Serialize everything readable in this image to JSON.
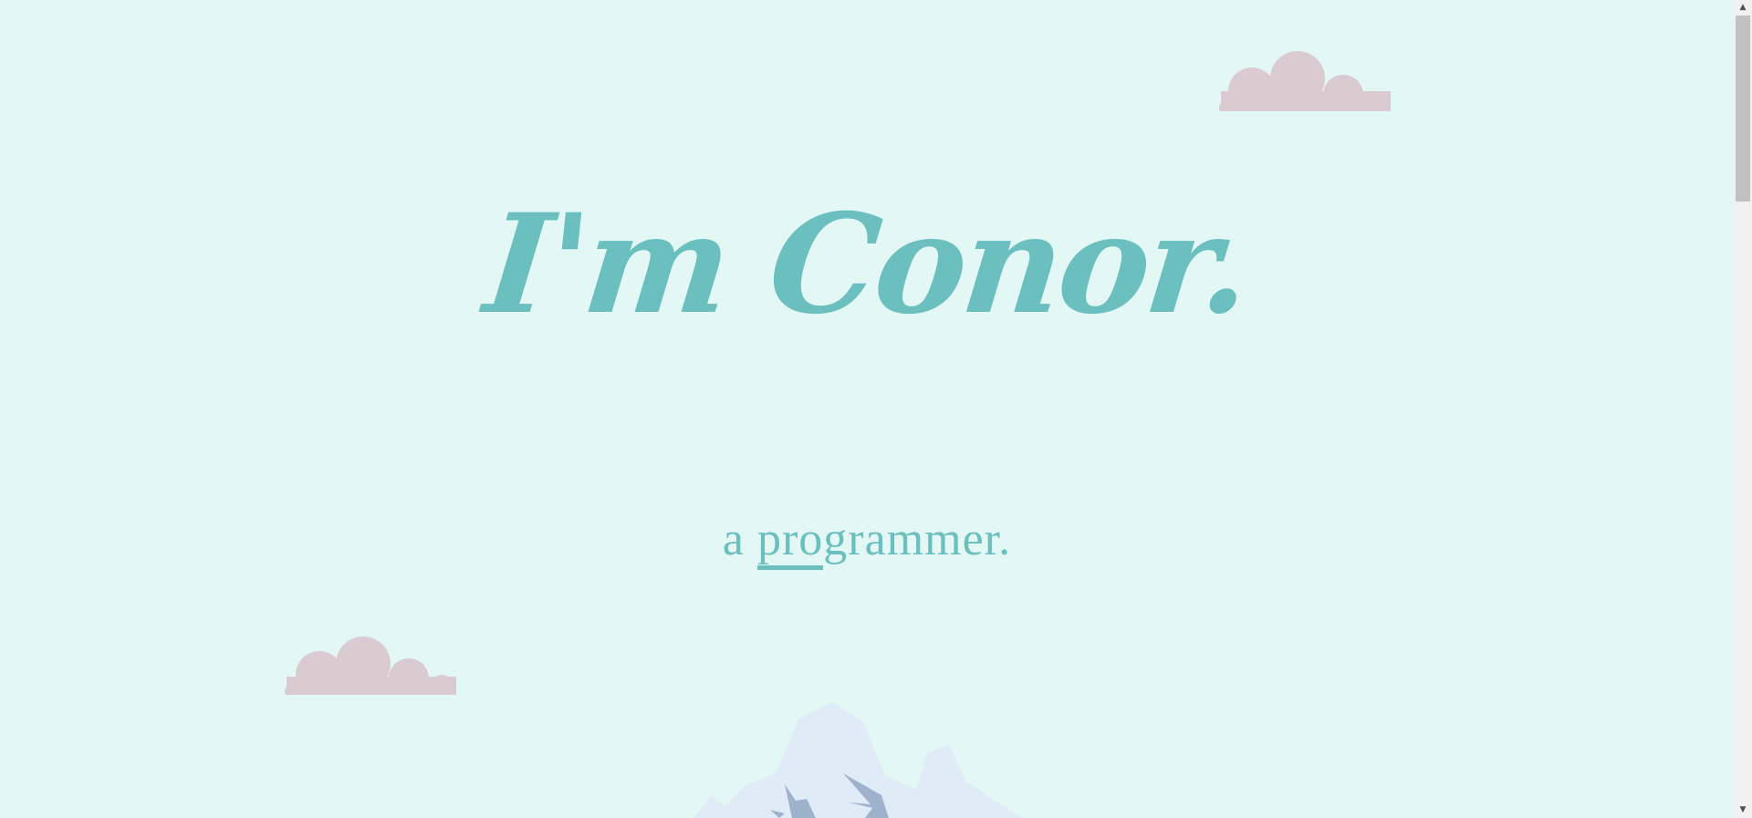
{
  "hero": {
    "headline": "I'm Conor.",
    "subtitle_prefix": "a ",
    "subtitle_highlight": "pro",
    "subtitle_rest": "grammer."
  },
  "colors": {
    "background": "#e3f7f4",
    "accent": "#6bc0bf",
    "cloud": "#dacbd1",
    "mountain_light": "#dfecf7",
    "mountain_shadow": "#9fb2cb"
  },
  "scrollbar": {
    "up_icon": "▲",
    "down_icon": "▼"
  }
}
